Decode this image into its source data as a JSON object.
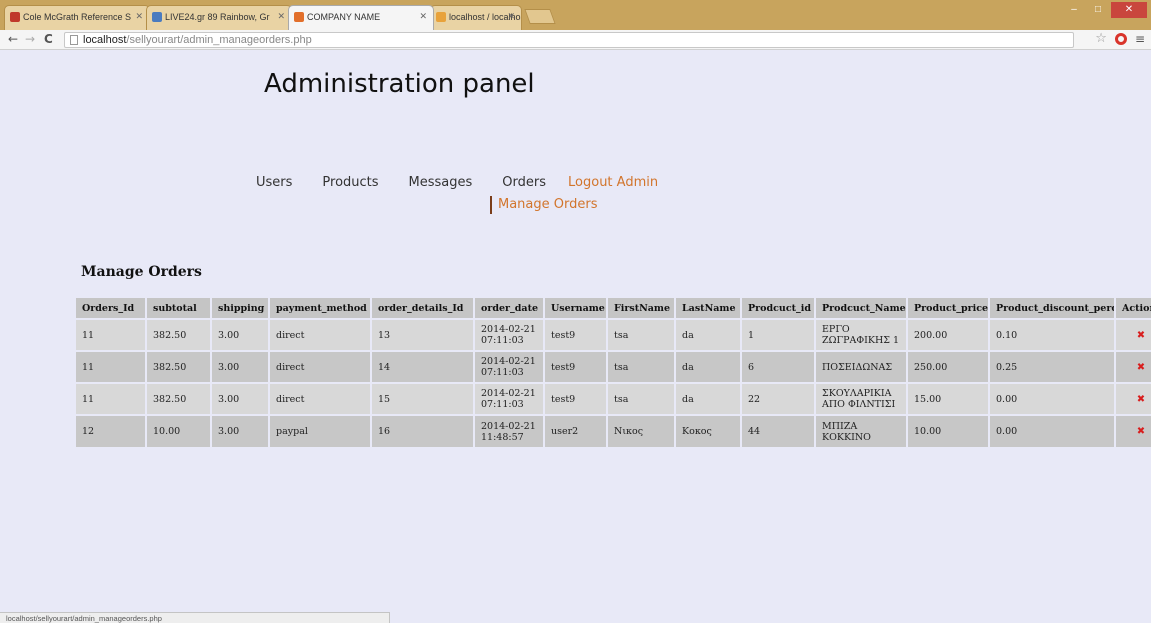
{
  "browser": {
    "tabs": [
      {
        "label": "Cole McGrath Reference S",
        "active": false
      },
      {
        "label": "LIVE24.gr 89 Rainbow, Gr",
        "active": false
      },
      {
        "label": "COMPANY NAME",
        "active": true
      },
      {
        "label": "localhost / localhost / sell",
        "active": false
      }
    ],
    "address_host": "localhost",
    "address_path": "/sellyourart/admin_manageorders.php",
    "status_url": "localhost/sellyourart/admin_manageorders.php"
  },
  "page": {
    "title": "Administration panel",
    "nav": [
      {
        "label": "Users"
      },
      {
        "label": "Products"
      },
      {
        "label": "Messages"
      },
      {
        "label": "Orders"
      },
      {
        "label": "Logout Admin"
      }
    ],
    "subnav_label": "Manage Orders",
    "section_title": "Manage Orders"
  },
  "table": {
    "headers": [
      "Orders_Id",
      "subtotal",
      "shipping",
      "payment_method",
      "order_details_Id",
      "order_date",
      "Username",
      "FirstName",
      "LastName",
      "Prodcuct_id",
      "Prodcuct_Name",
      "Product_price",
      "Product_discount_perc",
      "Actions"
    ],
    "rows": [
      [
        "11",
        "382.50",
        "3.00",
        "direct",
        "13",
        "2014-02-21 07:11:03",
        "test9",
        "tsa",
        "da",
        "1",
        "ΕΡΓΟ ΖΩΓΡΑΦΙΚΗΣ 1",
        "200.00",
        "0.10"
      ],
      [
        "11",
        "382.50",
        "3.00",
        "direct",
        "14",
        "2014-02-21 07:11:03",
        "test9",
        "tsa",
        "da",
        "6",
        "ΠΟΣΕΙΔΩΝΑΣ",
        "250.00",
        "0.25"
      ],
      [
        "11",
        "382.50",
        "3.00",
        "direct",
        "15",
        "2014-02-21 07:11:03",
        "test9",
        "tsa",
        "da",
        "22",
        "ΣΚΟΥΛΑΡΙΚΙΑ ΑΠΟ ΦΙΛΝΤΙΣΙ",
        "15.00",
        "0.00"
      ],
      [
        "12",
        "10.00",
        "3.00",
        "paypal",
        "16",
        "2014-02-21 11:48:57",
        "user2",
        "Νικος",
        "Κοκος",
        "44",
        "ΜΠΙΖΑ ΚΟΚΚΙΝΟ",
        "10.00",
        "0.00"
      ]
    ],
    "delete_glyph": "✖"
  },
  "colors": {
    "page_bg": "#e8e9f7",
    "accent": "#d2752c",
    "header_bg": "#c5c5c5",
    "delete": "#d81e1e"
  }
}
